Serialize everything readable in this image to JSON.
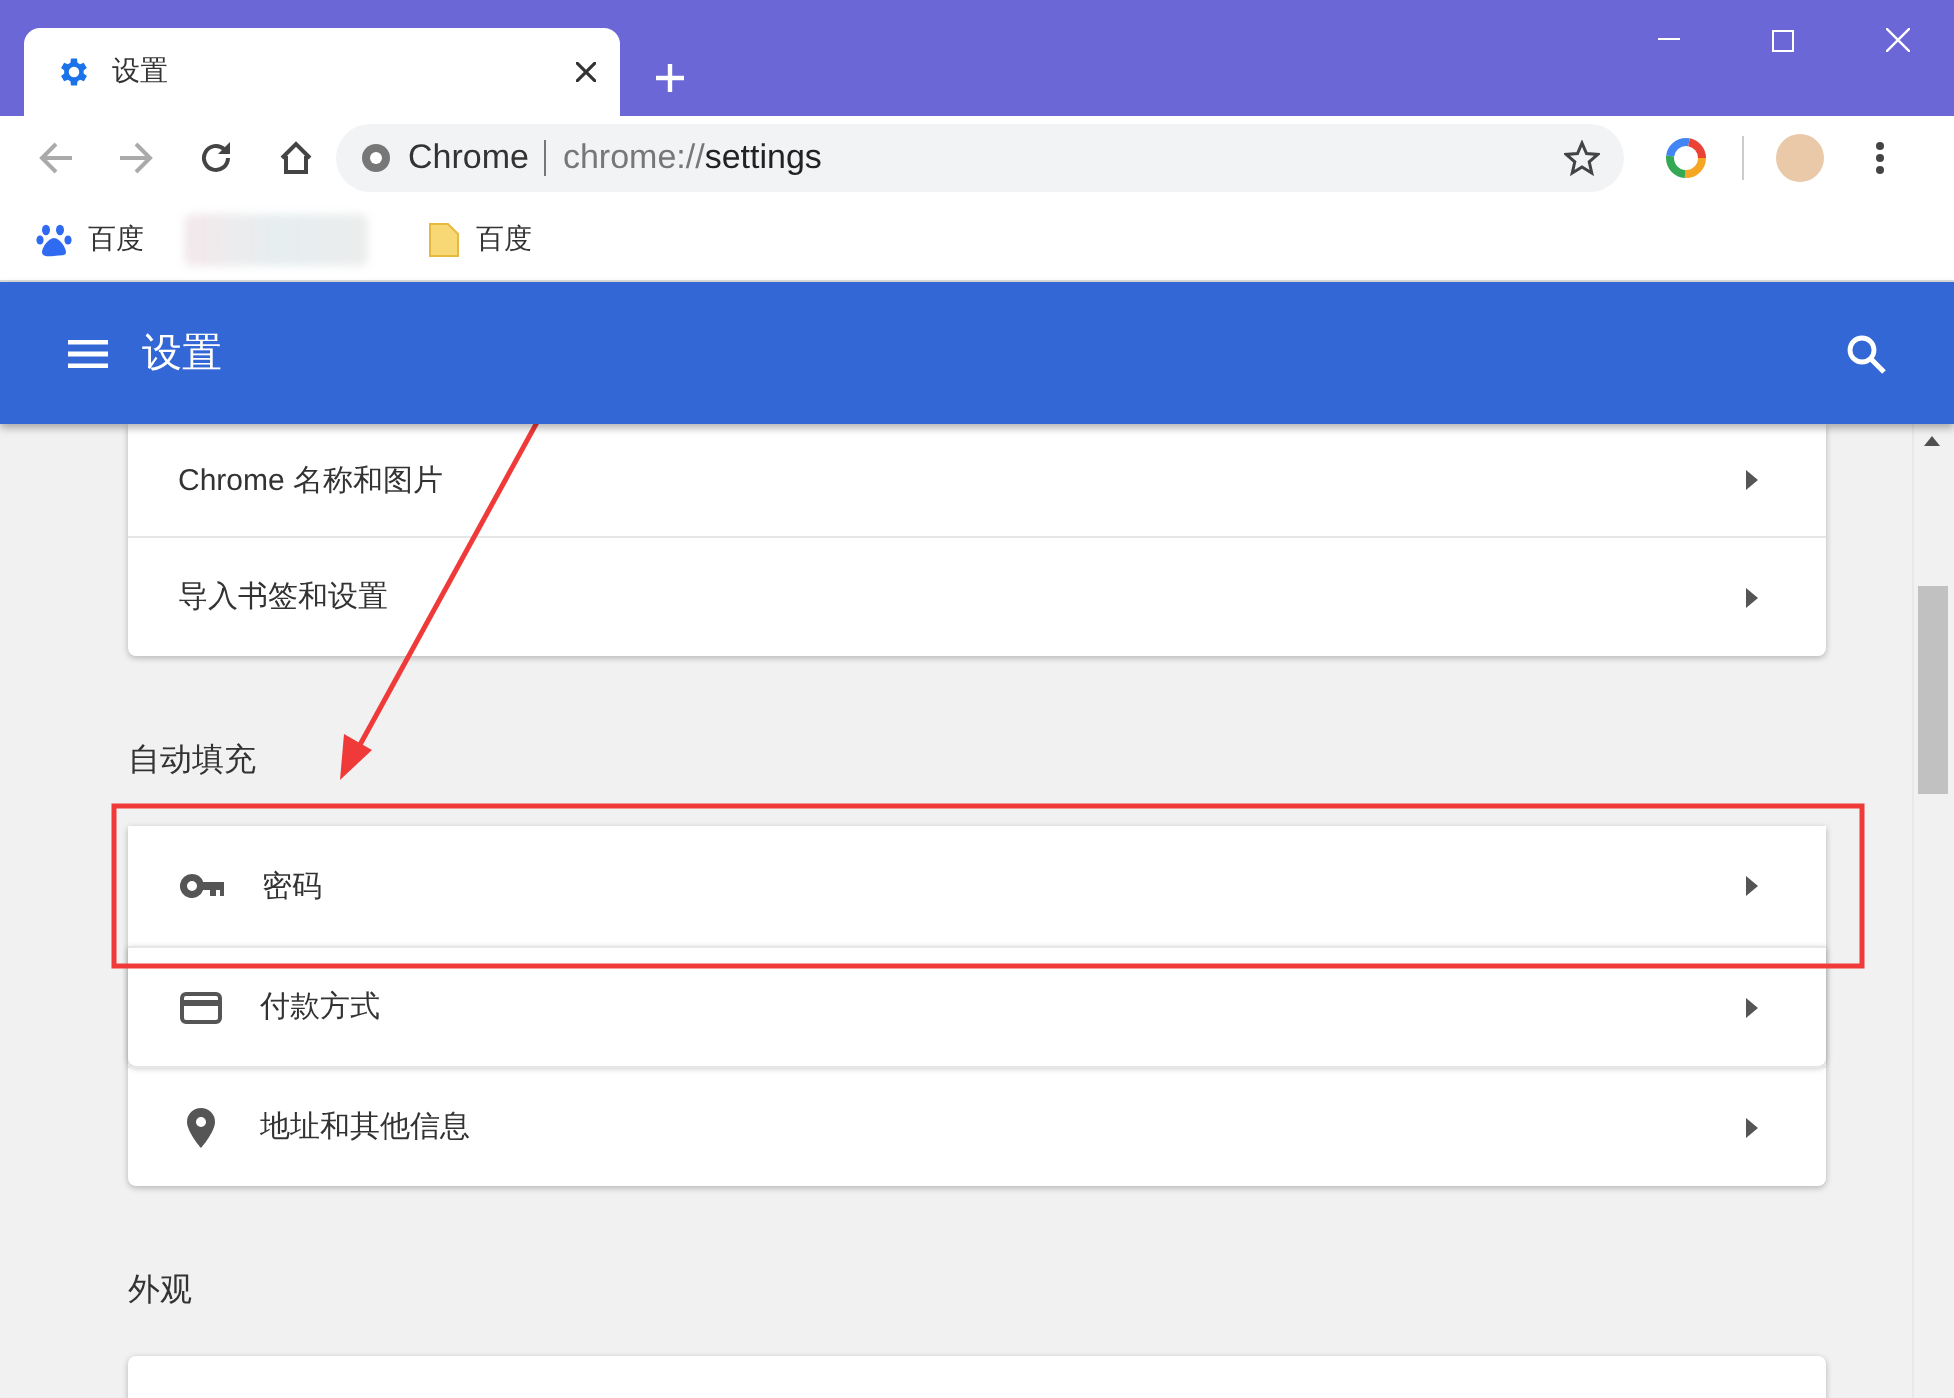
{
  "tabs": [
    {
      "title": "设置",
      "selected": true
    }
  ],
  "omnibox": {
    "site_label": "Chrome",
    "url_scheme": "chrome://",
    "url_path": "settings"
  },
  "bookmarks": [
    {
      "kind": "paw",
      "label": "百度"
    },
    {
      "kind": "blurred"
    },
    {
      "kind": "folder",
      "label": "百度"
    }
  ],
  "header": {
    "title": "设置"
  },
  "sections": [
    {
      "rows": [
        {
          "kind": "plain",
          "label": "Chrome 名称和图片"
        },
        {
          "kind": "plain",
          "label": "导入书签和设置"
        }
      ]
    },
    {
      "heading": "自动填充",
      "rows": [
        {
          "kind": "key",
          "label": "密码"
        },
        {
          "kind": "card",
          "label": "付款方式"
        },
        {
          "kind": "pin",
          "label": "地址和其他信息"
        }
      ]
    },
    {
      "heading": "外观"
    }
  ]
}
